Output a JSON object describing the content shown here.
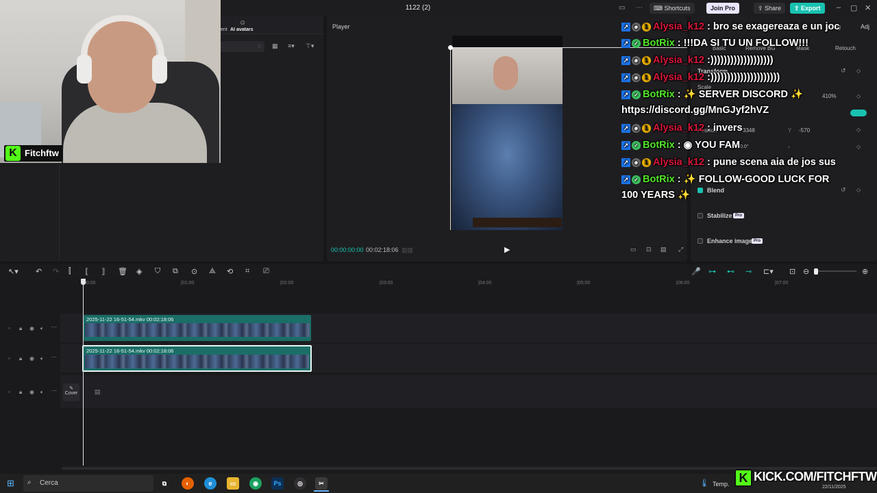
{
  "window": {
    "title": "1122 (2)",
    "shortcuts_label": "Shortcuts",
    "join_pro_label": "Join Pro",
    "share_label": "Share",
    "export_label": "Export"
  },
  "left_panel": {
    "tab_ai_avatars": "AI avatars",
    "tab_partial": "ent"
  },
  "webcam": {
    "streamer_name": "Fitchftw"
  },
  "player": {
    "label": "Player",
    "time_current": "00:00:00:00",
    "time_total": "00:02:18:06"
  },
  "right_panel": {
    "tabs": [
      "Basic",
      "Remove BG",
      "Mask",
      "Retouch"
    ],
    "partial_tab": "cking",
    "partial_tab2": "Adj",
    "transform_label": "Transform",
    "scale_label": "Scale",
    "scale_value": "410%",
    "position_label": "Position",
    "x_value": "3348",
    "y_label": "Y",
    "y_value": "-570",
    "rotate_value": "0.0°",
    "rotate_dash": "-",
    "blend_label": "Blend",
    "stabilize_label": "Stabilize",
    "enhance_label": "Enhance image",
    "pro_badge": "Pro"
  },
  "chat": [
    {
      "user": "Alysia_k12",
      "user_color": "#d9163a",
      "message": "bro se exagereaza e un joc"
    },
    {
      "user": "BotRix",
      "user_color": "#53e62a",
      "message": "!!!DA SI TU UN FOLLOW!!!"
    },
    {
      "user": "Alysia_k12",
      "user_color": "#d9163a",
      "message": ":)))))))))))))))))))"
    },
    {
      "user": "Alysia_k12",
      "user_color": "#d9163a",
      "message": ":)))))))))))))))))))))"
    },
    {
      "user": "BotRix",
      "user_color": "#53e62a",
      "message": "SERVER DISCORD",
      "link": "https://discord.gg/MnGJyf2hVZ"
    },
    {
      "user": "Alysia_k12",
      "user_color": "#d9163a",
      "message": "invers"
    },
    {
      "user": "BotRix",
      "user_color": "#53e62a",
      "message": "YOU FAM"
    },
    {
      "user": "Alysia_k12",
      "user_color": "#d9163a",
      "message": "pune scena aia de jos sus"
    },
    {
      "user": "BotRix",
      "user_color": "#53e62a",
      "message": "FOLLOW-GOOD LUCK FOR 100 YEARS"
    }
  ],
  "timeline": {
    "ruler": [
      "00:00",
      "|01:00",
      "|02:00",
      "|03:00",
      "|04:00",
      "|05:00",
      "|06:00",
      "|07:00"
    ],
    "clips": [
      {
        "name": "2025-11-22 16-51-54.mkv",
        "duration": "00:02:18:06"
      },
      {
        "name": "2025-11-22 16-51-54.mkv",
        "duration": "00:02:18:06"
      }
    ],
    "cover_label": "Cover"
  },
  "taskbar": {
    "search_placeholder": "Cerca",
    "temp_label": "Temp.",
    "date": "22/11/2025",
    "kick_banner": "KICK.COM/FITCHFTW"
  },
  "colors": {
    "accent": "#19c2b0",
    "kick_green": "#53fc18",
    "chat_red": "#d9163a",
    "chat_green": "#53e62a"
  }
}
